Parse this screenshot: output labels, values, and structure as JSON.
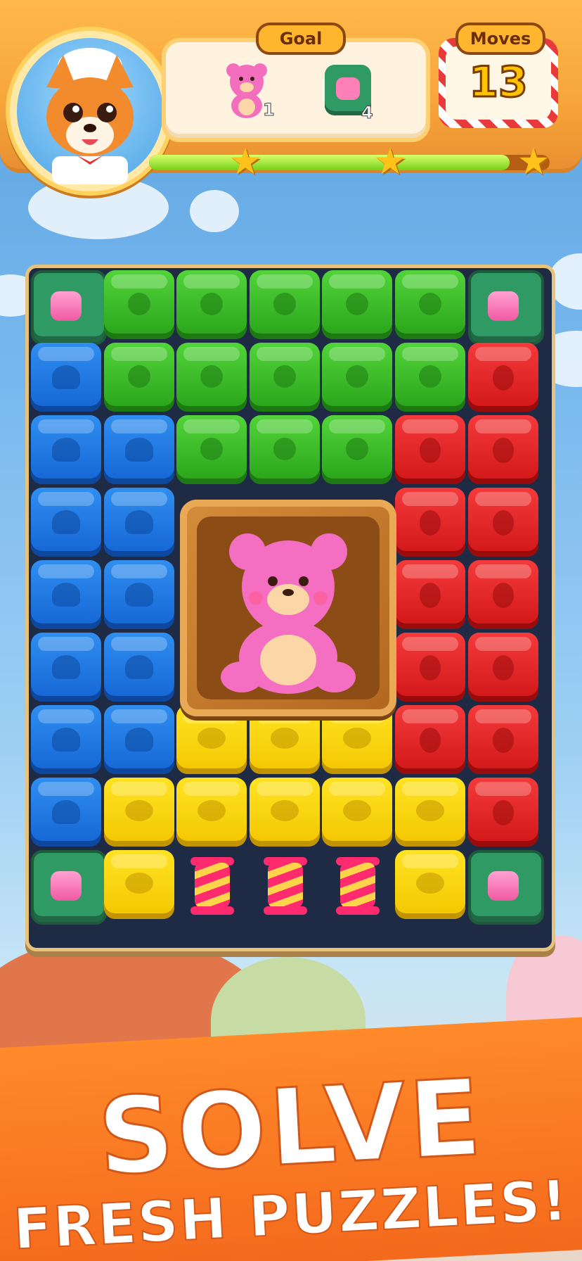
{
  "header": {
    "avatar_icon": "corgi-chef-icon",
    "goal_label": "Goal",
    "moves_label": "Moves",
    "moves_value": "13",
    "goals": [
      {
        "icon": "pink-bear-icon",
        "count": "1"
      },
      {
        "icon": "jelly-jar-tile-icon",
        "count": "4"
      }
    ],
    "progress_fraction": 0.9,
    "stars": [
      "star-icon",
      "star-icon",
      "star-icon"
    ]
  },
  "board": {
    "columns": 7,
    "rows": 9,
    "colors": {
      "green": "#29a31a",
      "blue": "#1565d4",
      "red": "#d01616",
      "yellow": "#f3c600",
      "jar": "#2f9a63"
    },
    "grid": [
      [
        "jar",
        "green",
        "green",
        "green",
        "green",
        "green",
        "jar"
      ],
      [
        "blue",
        "green",
        "green",
        "green",
        "green",
        "green",
        "red"
      ],
      [
        "blue",
        "blue",
        "green",
        "green",
        "green",
        "red",
        "red"
      ],
      [
        "blue",
        "blue",
        "crate",
        "crate",
        "crate",
        "red",
        "red"
      ],
      [
        "blue",
        "blue",
        "crate",
        "crate",
        "crate",
        "red",
        "red"
      ],
      [
        "blue",
        "blue",
        "crate",
        "crate",
        "crate",
        "red",
        "red"
      ],
      [
        "blue",
        "blue",
        "yellow",
        "yellow",
        "yellow",
        "red",
        "red"
      ],
      [
        "blue",
        "yellow",
        "yellow",
        "yellow",
        "yellow",
        "yellow",
        "red"
      ],
      [
        "jar",
        "yellow",
        "candy",
        "candy",
        "candy",
        "yellow",
        "jar"
      ]
    ],
    "crate_icon": "pink-bear-crate-icon",
    "candy_icon": "candy-rocket-icon"
  },
  "banner": {
    "headline": "SOLVE",
    "subline": "FRESH PUZZLES!"
  }
}
